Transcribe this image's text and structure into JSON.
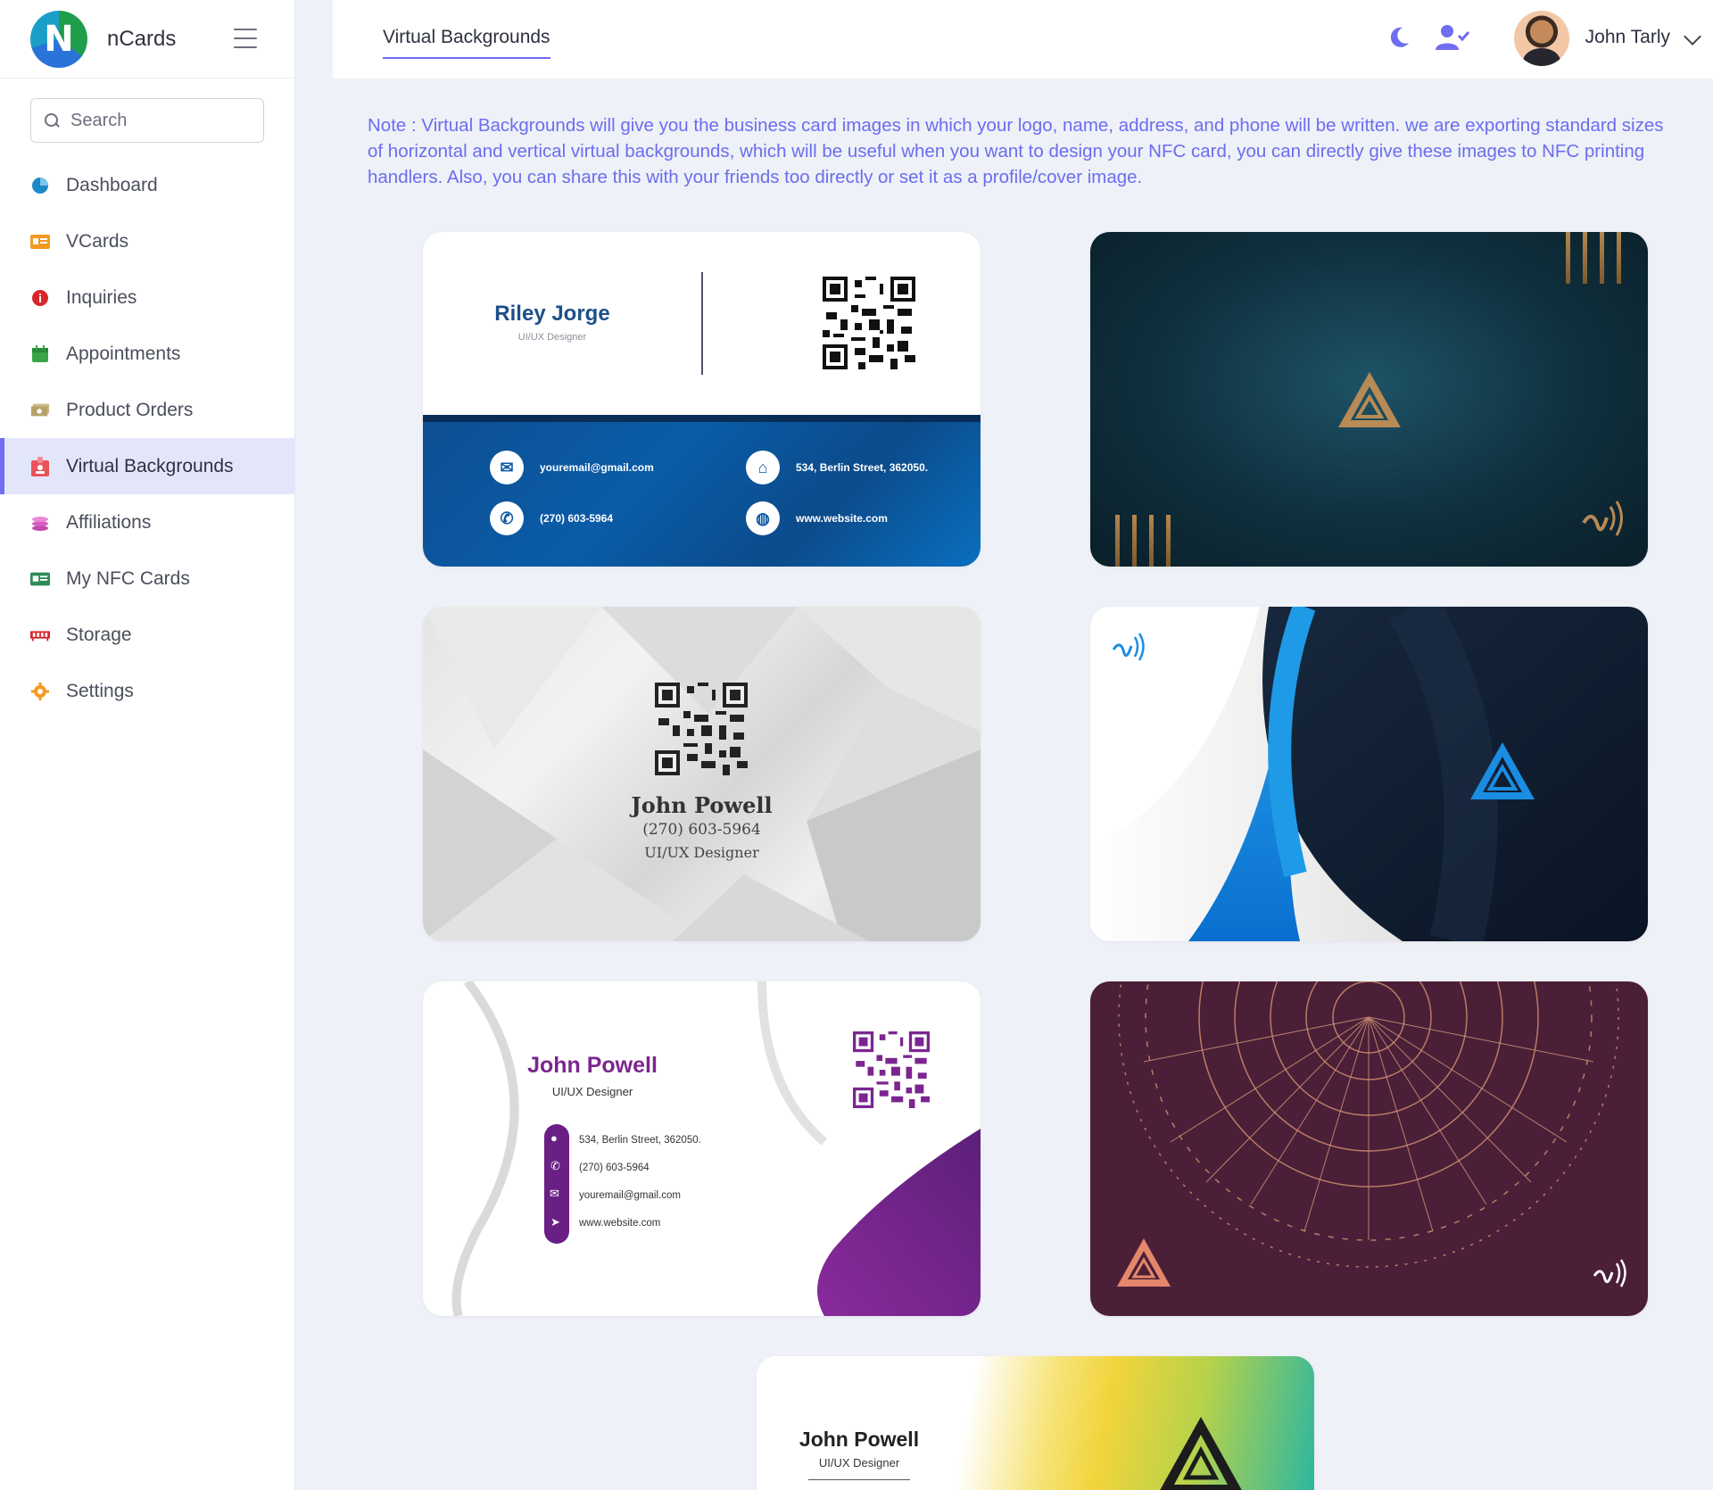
{
  "app": {
    "name": "nCards",
    "logo_letter": "N"
  },
  "search": {
    "placeholder": "Search"
  },
  "sidebar": {
    "items": [
      {
        "label": "Dashboard",
        "icon": "pie-chart-icon",
        "color": "#1e88c7"
      },
      {
        "label": "VCards",
        "icon": "id-card-icon",
        "color": "#f29a1f"
      },
      {
        "label": "Inquiries",
        "icon": "info-icon",
        "color": "#d9262b"
      },
      {
        "label": "Appointments",
        "icon": "calendar-icon",
        "color": "#3aa548"
      },
      {
        "label": "Product Orders",
        "icon": "money-icon",
        "color": "#b9a26a"
      },
      {
        "label": "Virtual Backgrounds",
        "icon": "badge-icon",
        "color": "#e9535b"
      },
      {
        "label": "Affiliations",
        "icon": "coins-icon",
        "color": "#d75cc2"
      },
      {
        "label": "My NFC Cards",
        "icon": "nfc-card-icon",
        "color": "#2e8b57"
      },
      {
        "label": "Storage",
        "icon": "memory-icon",
        "color": "#d9262b"
      },
      {
        "label": "Settings",
        "icon": "gear-icon",
        "color": "#f29a1f"
      }
    ],
    "active_index": 5
  },
  "header": {
    "tab_label": "Virtual Backgrounds",
    "user_name": "John Tarly"
  },
  "note": "Note : Virtual Backgrounds will give you the business card images in which your logo, name, address, and phone will be written. we are exporting standard sizes of horizontal and vertical virtual backgrounds, which will be useful when you want to design your NFC card, you can directly give these images to NFC printing handlers. Also, you can share this with your friends too directly or set it as a profile/cover image.",
  "cards": {
    "card1": {
      "name": "Riley Jorge",
      "title": "UI/UX Designer",
      "email": "youremail@gmail.com",
      "phone": "(270) 603-5964",
      "address": "534, Berlin Street, 362050.",
      "website": "www.website.com"
    },
    "card3": {
      "name": "John Powell",
      "phone": "(270) 603-5964",
      "title": "UI/UX Designer"
    },
    "card5": {
      "name": "John Powell",
      "title": "UI/UX Designer",
      "address": "534, Berlin Street, 362050.",
      "phone": "(270) 603-5964",
      "email": "youremail@gmail.com",
      "website": "www.website.com"
    },
    "card7": {
      "name": "John Powell",
      "title": "UI/UX Designer"
    }
  },
  "colors": {
    "accent": "#6f6df0",
    "note_text": "#6b6df0",
    "active_bg": "#e3e6fb"
  }
}
